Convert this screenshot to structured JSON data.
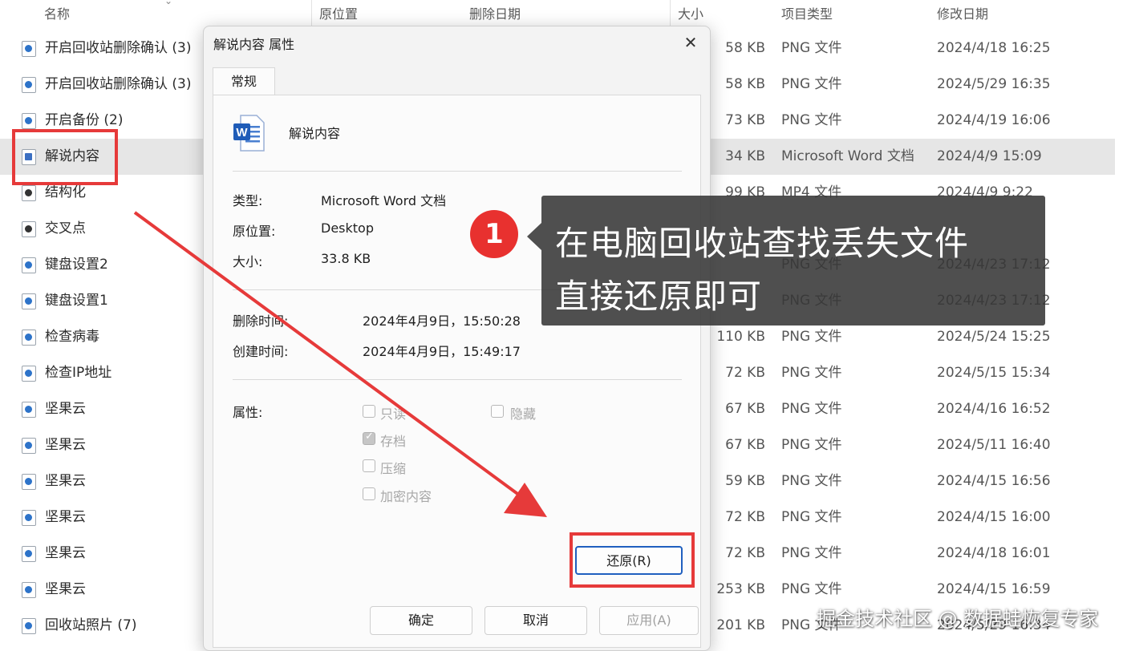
{
  "columns": {
    "name": "名称",
    "origin": "原位置",
    "deleted": "删除日期",
    "size": "大小",
    "type": "项目类型",
    "modified": "修改日期"
  },
  "files": [
    {
      "name": "开启回收站删除确认 (3)",
      "size": "58 KB",
      "type": "PNG 文件",
      "modified": "2024/4/18 16:25",
      "icon": "png-image-icon"
    },
    {
      "name": "开启回收站删除确认 (3)",
      "size": "58 KB",
      "type": "PNG 文件",
      "modified": "2024/5/29 16:35",
      "icon": "png-image-icon"
    },
    {
      "name": "开启备份 (2)",
      "size": "73 KB",
      "type": "PNG 文件",
      "modified": "2024/4/19 16:06",
      "icon": "png-image-icon"
    },
    {
      "name": "解说内容",
      "size": "34 KB",
      "type": "Microsoft Word 文档",
      "modified": "2024/4/9 15:09",
      "icon": "word-document-icon"
    },
    {
      "name": "结构化",
      "size": "99 KB",
      "type": "MP4 文件",
      "modified": "2024/4/9 9:22",
      "icon": "video-file-icon"
    },
    {
      "name": "交叉点",
      "size": "",
      "type": "",
      "modified": "",
      "icon": "video-file-icon"
    },
    {
      "name": "键盘设置2",
      "size": "",
      "type": "PNG 文件",
      "modified": "2024/4/23 17:12",
      "icon": "png-image-icon"
    },
    {
      "name": "键盘设置1",
      "size": "",
      "type": "PNG 文件",
      "modified": "2024/4/23 17:12",
      "icon": "png-image-icon"
    },
    {
      "name": "检查病毒",
      "size": "110 KB",
      "type": "PNG 文件",
      "modified": "2024/5/24 15:25",
      "icon": "png-image-icon"
    },
    {
      "name": "检查IP地址",
      "size": "72 KB",
      "type": "PNG 文件",
      "modified": "2024/5/15 15:34",
      "icon": "png-image-icon"
    },
    {
      "name": "坚果云",
      "size": "67 KB",
      "type": "PNG 文件",
      "modified": "2024/4/16 16:52",
      "icon": "png-image-icon"
    },
    {
      "name": "坚果云",
      "size": "67 KB",
      "type": "PNG 文件",
      "modified": "2024/5/11 16:40",
      "icon": "png-image-icon"
    },
    {
      "name": "坚果云",
      "size": "59 KB",
      "type": "PNG 文件",
      "modified": "2024/4/15 16:56",
      "icon": "png-image-icon"
    },
    {
      "name": "坚果云",
      "size": "72 KB",
      "type": "PNG 文件",
      "modified": "2024/4/15 16:00",
      "icon": "png-image-icon"
    },
    {
      "name": "坚果云",
      "size": "72 KB",
      "type": "PNG 文件",
      "modified": "2024/4/18 16:01",
      "icon": "png-image-icon"
    },
    {
      "name": "坚果云",
      "size": "253 KB",
      "type": "PNG 文件",
      "modified": "2024/4/15 16:59",
      "icon": "png-image-icon"
    },
    {
      "name": "回收站照片 (7)",
      "size": "201 KB",
      "type": "PNG 文件",
      "modified": "2024/5/29 16:34",
      "icon": "png-image-icon"
    }
  ],
  "selected_index": 3,
  "dialog": {
    "title": "解说内容 属性",
    "close_icon": "close-icon",
    "tab": "常规",
    "file_name": "解说内容",
    "type_label": "类型:",
    "type_value": "Microsoft Word 文档",
    "origin_label": "原位置:",
    "origin_value": "Desktop",
    "size_label": "大小:",
    "size_value": "33.8 KB",
    "deleted_label": "删除时间:",
    "deleted_value": "2024年4月9日，15:50:28",
    "created_label": "创建时间:",
    "created_value": "2024年4月9日，15:49:17",
    "attributes_label": "属性:",
    "attributes": [
      {
        "label": "只读",
        "checked": false
      },
      {
        "label": "隐藏",
        "checked": false
      },
      {
        "label": "存档",
        "checked": true
      },
      {
        "label": "压缩",
        "checked": false
      },
      {
        "label": "加密内容",
        "checked": false
      }
    ],
    "restore_button": "还原(R)",
    "ok_button": "确定",
    "cancel_button": "取消",
    "apply_button": "应用(A)"
  },
  "overlay": {
    "step_number": "1",
    "line1": "在电脑回收站查找丢失文件",
    "line2": "直接还原即可",
    "watermark": "掘金技术社区 @ 数据蛙恢复专家",
    "accent": "#e63a3a"
  }
}
